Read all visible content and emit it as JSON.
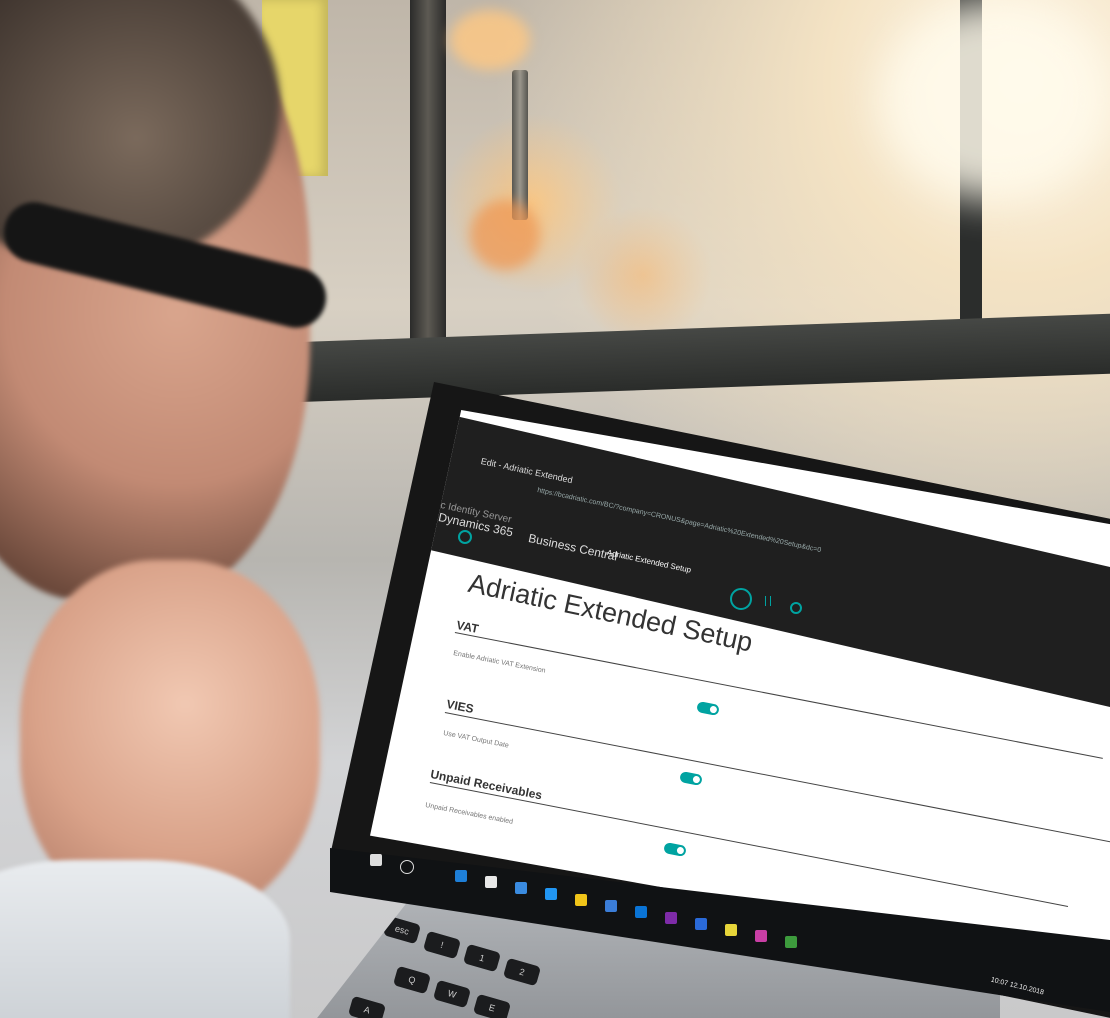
{
  "browser": {
    "title_bar": "Adriatic Identity Server",
    "tab_title": "Edit - Adriatic Extended",
    "url": "https://bcadriatic.com/BC/?company=CRONUS&page=Adriatic%20Extended%20Setup&dc=0"
  },
  "app": {
    "product": "Dynamics 365",
    "module": "Business Central",
    "page_name": "Adriatic Extended Setup"
  },
  "page": {
    "title": "Adriatic Extended Setup",
    "sections": [
      {
        "heading": "VAT",
        "field_label": "Enable Adriatic VAT Extension",
        "enabled": true
      },
      {
        "heading": "VIES",
        "field_label": "Use VAT Output Date",
        "enabled": true
      },
      {
        "heading": "Unpaid Receivables",
        "field_label": "Unpaid Receivables enabled",
        "enabled": true
      }
    ]
  },
  "taskbar": {
    "clock": "10:07 12.10.2018"
  },
  "keyboard": {
    "keys": [
      "esc",
      "!",
      "Q",
      "W",
      "E",
      "A",
      "1",
      "2"
    ]
  },
  "colors": {
    "accent": "#00a3a1",
    "browser_chrome": "#1f1f1f",
    "taskbar": "#101214"
  }
}
